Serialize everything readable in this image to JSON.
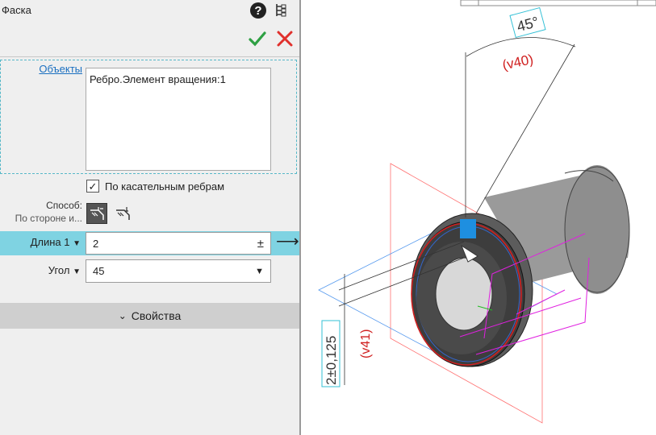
{
  "panel": {
    "title": "Фаска",
    "help_icon": "question-icon",
    "tree_icon": "tree-icon",
    "ok_icon": "checkmark-icon",
    "cancel_icon": "close-icon",
    "objects_label": "Объекты",
    "objects_items": [
      "Ребро.Элемент вращения:1"
    ],
    "tangent_checkbox": {
      "label": "По касательным ребрам",
      "checked": true
    },
    "method": {
      "label": "Способ:",
      "value": "По стороне и..."
    },
    "length": {
      "label": "Длина 1",
      "value": "2",
      "tolerance_symbol": "±",
      "arrow": "⟶"
    },
    "angle": {
      "label": "Угол",
      "value": "45"
    },
    "properties_label": "Свойства"
  },
  "viewport": {
    "angle_dimension": "45°",
    "angle_variable": "(v40)",
    "length_dimension": "2±0,125",
    "length_variable": "(v41)"
  },
  "colors": {
    "accent": "#7fd3e2",
    "ok": "#2ea043",
    "cancel": "#e0302c",
    "link": "#1a6fc0"
  }
}
